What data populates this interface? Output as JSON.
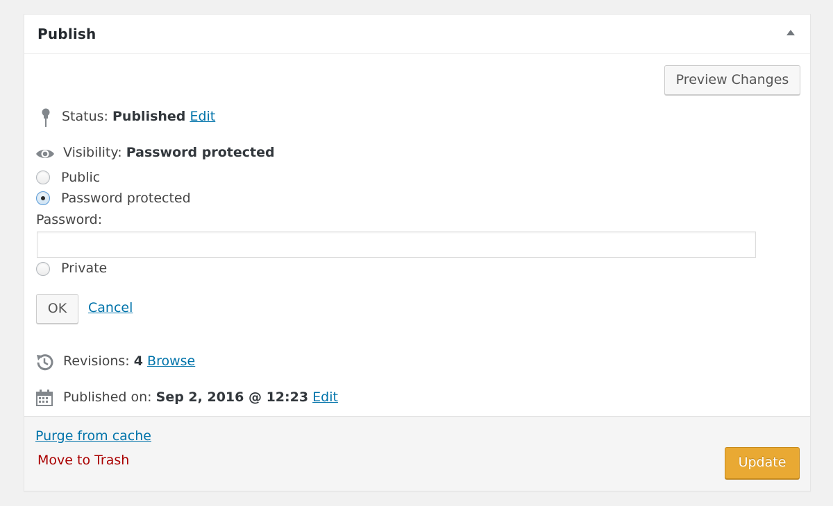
{
  "publish_box": {
    "title": "Publish",
    "preview_label": "Preview Changes"
  },
  "status": {
    "label": "Status:",
    "value": "Published",
    "edit_label": "Edit"
  },
  "visibility": {
    "label": "Visibility:",
    "value": "Password protected",
    "options": [
      {
        "label": "Public",
        "checked": false
      },
      {
        "label": "Password protected",
        "checked": true
      },
      {
        "label": "Private",
        "checked": false
      }
    ],
    "password_label": "Password:",
    "password_value": "",
    "ok_label": "OK",
    "cancel_label": "Cancel"
  },
  "revisions": {
    "label": "Revisions:",
    "count": "4",
    "browse_label": "Browse"
  },
  "published_on": {
    "label": "Published on:",
    "value": "Sep 2, 2016 @ 12:23",
    "edit_label": "Edit"
  },
  "footer": {
    "purge_label": "Purge from cache",
    "trash_label": "Move to Trash",
    "update_label": "Update"
  },
  "colors": {
    "link": "#0073aa",
    "trash": "#aa0000",
    "update_button": "#e9a933"
  },
  "icons": [
    "pin-icon",
    "eye-icon",
    "history-icon",
    "calendar-icon",
    "collapse-arrow-icon"
  ]
}
